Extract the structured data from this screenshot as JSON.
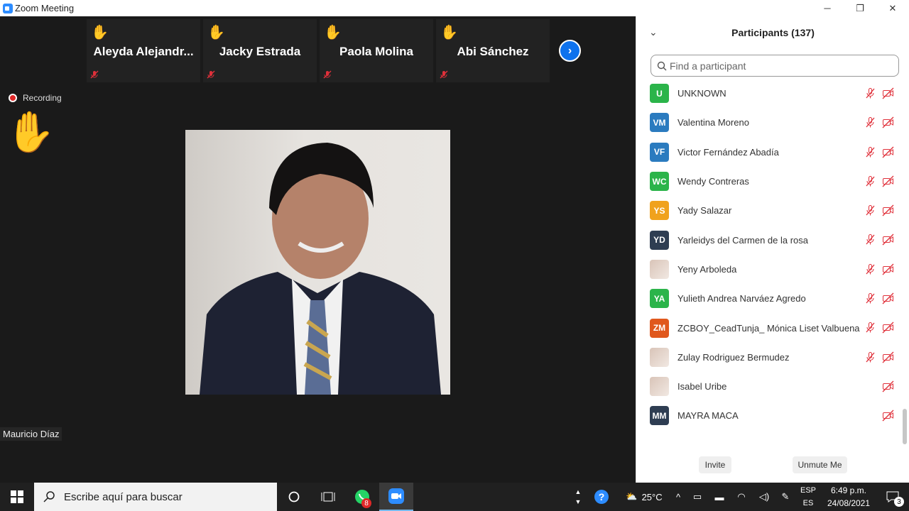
{
  "window": {
    "title": "Zoom Meeting",
    "controls": {
      "minimize": "─",
      "restore": "❐",
      "close": "✕"
    }
  },
  "thumbnails": [
    {
      "name": "Aleyda  Alejandr..."
    },
    {
      "name": "Jacky Estrada"
    },
    {
      "name": "Paola Molina"
    },
    {
      "name": "Abi Sánchez"
    }
  ],
  "recording_label": "Recording",
  "active_speaker": "Mauricio Díaz",
  "participants_panel": {
    "title": "Participants (137)",
    "search_placeholder": "Find a participant",
    "items": [
      {
        "initials": "U",
        "name": "UNKNOWN",
        "color": "#2bb44a",
        "mic_muted": true,
        "video_off": true
      },
      {
        "initials": "VM",
        "name": "Valentina Moreno",
        "color": "#2b7bbf",
        "mic_muted": true,
        "video_off": true
      },
      {
        "initials": "VF",
        "name": "Victor Fernández Abadía",
        "color": "#2b7bbf",
        "mic_muted": true,
        "video_off": true
      },
      {
        "initials": "WC",
        "name": "Wendy Contreras",
        "color": "#2bb44a",
        "mic_muted": true,
        "video_off": true
      },
      {
        "initials": "YS",
        "name": "Yady Salazar",
        "color": "#f0a21d",
        "mic_muted": true,
        "video_off": true
      },
      {
        "initials": "YD",
        "name": "Yarleidys del Carmen de la rosa",
        "color": "#2e3d52",
        "mic_muted": true,
        "video_off": true
      },
      {
        "initials": "",
        "name": "Yeny Arboleda",
        "color": "photo",
        "mic_muted": true,
        "video_off": true
      },
      {
        "initials": "YA",
        "name": "Yulieth Andrea Narváez Agredo",
        "color": "#2bb44a",
        "mic_muted": true,
        "video_off": true
      },
      {
        "initials": "ZM",
        "name": "ZCBOY_CeadTunja_ Mónica Liset Valbuena",
        "color": "#e0581d",
        "mic_muted": true,
        "video_off": true
      },
      {
        "initials": "",
        "name": "Zulay Rodriguez Bermudez",
        "color": "photo",
        "mic_muted": true,
        "video_off": true
      },
      {
        "initials": "",
        "name": "Isabel Uribe",
        "color": "photo",
        "mic_muted": false,
        "video_off": true
      },
      {
        "initials": "MM",
        "name": "MAYRA MACA",
        "color": "#2e3d52",
        "mic_muted": false,
        "video_off": true
      }
    ],
    "invite_label": "Invite",
    "unmute_label": "Unmute Me"
  },
  "taskbar": {
    "search_text": "Escribe aquí para buscar",
    "whatsapp_badge": "8",
    "weather": "25°C",
    "lang_top": "ESP",
    "lang_bottom": "ES",
    "time": "6:49 p.m.",
    "date": "24/08/2021",
    "notifications": "3"
  },
  "colors": {
    "accent": "#0e72ed",
    "muted_icon": "#e0303a"
  }
}
